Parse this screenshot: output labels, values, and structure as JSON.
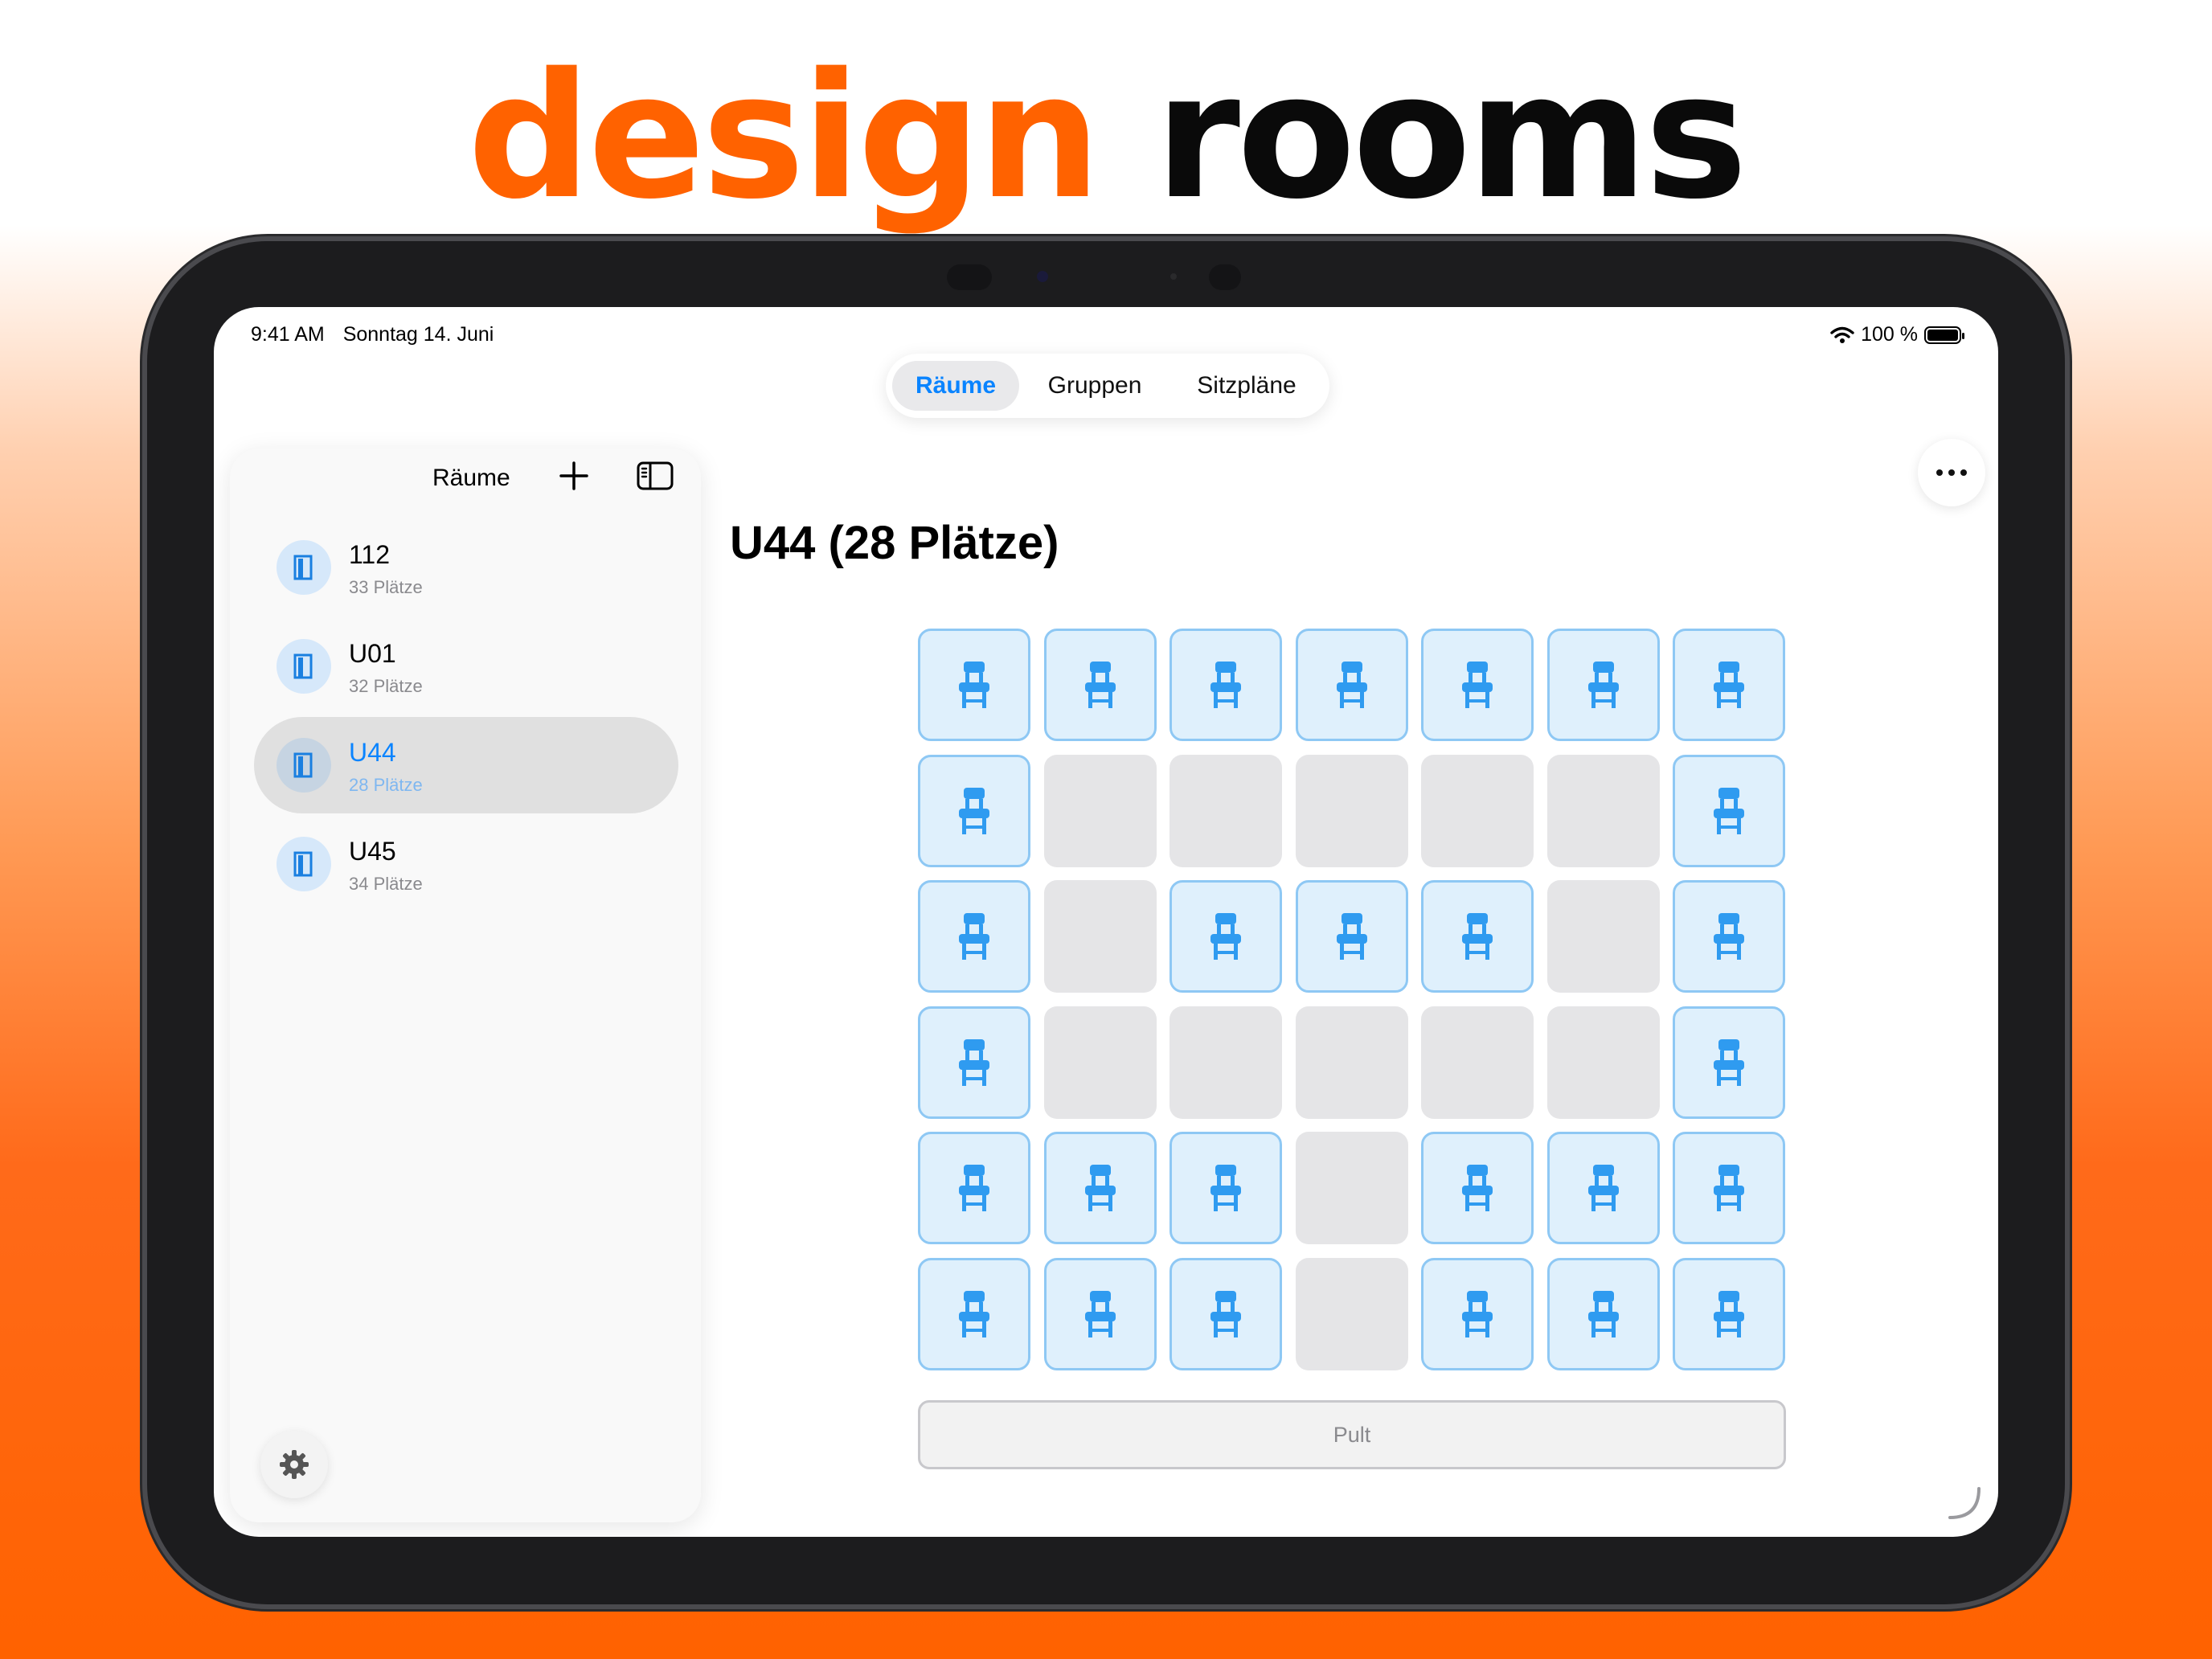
{
  "headline": {
    "accent": "design",
    "rest": "rooms"
  },
  "statusbar": {
    "time": "9:41 AM",
    "date": "Sonntag 14. Juni",
    "battery": "100 %",
    "battery_level": 1.0
  },
  "tabs": [
    {
      "label": "Räume",
      "active": true
    },
    {
      "label": "Gruppen",
      "active": false
    },
    {
      "label": "Sitzpläne",
      "active": false
    }
  ],
  "sidebar": {
    "title": "Räume",
    "rooms": [
      {
        "name": "112",
        "seats": "33 Plätze",
        "active": false
      },
      {
        "name": "U01",
        "seats": "32 Plätze",
        "active": false
      },
      {
        "name": "U44",
        "seats": "28 Plätze",
        "active": true
      },
      {
        "name": "U45",
        "seats": "34 Plätze",
        "active": false
      }
    ]
  },
  "room": {
    "title": "U44 (28 Plätze)",
    "layout": [
      [
        1,
        1,
        1,
        1,
        1,
        1,
        1
      ],
      [
        1,
        0,
        0,
        0,
        0,
        0,
        1
      ],
      [
        1,
        0,
        1,
        1,
        1,
        0,
        1
      ],
      [
        1,
        0,
        0,
        0,
        0,
        0,
        1
      ],
      [
        1,
        1,
        1,
        0,
        1,
        1,
        1
      ],
      [
        1,
        1,
        1,
        0,
        1,
        1,
        1
      ]
    ],
    "desk_label": "Pult"
  },
  "colors": {
    "accent": "#ff6200",
    "tint": "#0a84ff",
    "seat_icon": "#2f9bf0"
  },
  "icons": [
    "chair-icon",
    "door-icon",
    "plus-icon",
    "sidebar-toggle-icon",
    "gear-icon",
    "ellipsis-icon",
    "wifi-icon",
    "battery-icon"
  ]
}
